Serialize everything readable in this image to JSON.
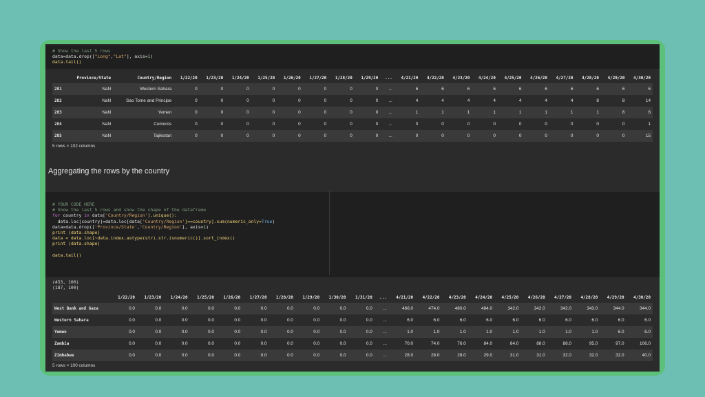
{
  "cell1": {
    "code_lines": [
      [
        {
          "t": "# Show the last 5 rows",
          "c": "c-comment"
        }
      ],
      [
        {
          "t": "data=data.drop([",
          "c": "c-op"
        },
        {
          "t": "\"Long\"",
          "c": "c-str"
        },
        {
          "t": ",",
          "c": "c-op"
        },
        {
          "t": "\"Lat\"",
          "c": "c-str"
        },
        {
          "t": "], axis=",
          "c": "c-op"
        },
        {
          "t": "1",
          "c": "c-num"
        },
        {
          "t": ")",
          "c": "c-op"
        }
      ],
      [
        {
          "t": "data.tail()",
          "c": "c-fn"
        }
      ]
    ]
  },
  "table1": {
    "headers": [
      "",
      "Province/State",
      "Country/Region",
      "1/22/20",
      "1/23/20",
      "1/24/20",
      "1/25/20",
      "1/26/20",
      "1/27/20",
      "1/28/20",
      "1/29/20",
      "...",
      "4/21/20",
      "4/22/20",
      "4/23/20",
      "4/24/20",
      "4/25/20",
      "4/26/20",
      "4/27/20",
      "4/28/20",
      "4/29/20",
      "4/30/20"
    ],
    "rows": [
      [
        "281",
        "NaN",
        "Western Sahara",
        "0",
        "0",
        "0",
        "0",
        "0",
        "0",
        "0",
        "0",
        "...",
        "6",
        "6",
        "6",
        "6",
        "6",
        "6",
        "6",
        "6",
        "6",
        "6"
      ],
      [
        "282",
        "NaN",
        "Sao Tome and Principe",
        "0",
        "0",
        "0",
        "0",
        "0",
        "0",
        "0",
        "0",
        "...",
        "4",
        "4",
        "4",
        "4",
        "4",
        "4",
        "4",
        "8",
        "8",
        "14"
      ],
      [
        "283",
        "NaN",
        "Yemen",
        "0",
        "0",
        "0",
        "0",
        "0",
        "0",
        "0",
        "0",
        "...",
        "1",
        "1",
        "1",
        "1",
        "1",
        "1",
        "1",
        "1",
        "6",
        "6"
      ],
      [
        "284",
        "NaN",
        "Comoros",
        "0",
        "0",
        "0",
        "0",
        "0",
        "0",
        "0",
        "0",
        "...",
        "0",
        "0",
        "0",
        "0",
        "0",
        "0",
        "0",
        "0",
        "0",
        "1"
      ],
      [
        "285",
        "NaN",
        "Tajikistan",
        "0",
        "0",
        "0",
        "0",
        "0",
        "0",
        "0",
        "0",
        "...",
        "0",
        "0",
        "0",
        "0",
        "0",
        "0",
        "0",
        "0",
        "0",
        "15"
      ]
    ],
    "shape_note": "5 rows × 102 columns"
  },
  "markdown": {
    "heading": "Aggregating the rows by the country"
  },
  "cell2": {
    "code_lines": [
      [
        {
          "t": "# YOUR CODE HERE",
          "c": "c-comment"
        }
      ],
      [
        {
          "t": "# Show the last 5 rows and show the shape of the dataframe",
          "c": "c-comment"
        }
      ],
      [
        {
          "t": "for",
          "c": "c-kw"
        },
        {
          "t": " country ",
          "c": "c-op"
        },
        {
          "t": "in",
          "c": "c-kw"
        },
        {
          "t": " data[",
          "c": "c-op"
        },
        {
          "t": "'Country/Region'",
          "c": "c-str"
        },
        {
          "t": "].unique():",
          "c": "c-fn"
        }
      ],
      [
        {
          "t": "  data.loc[country]=data.loc[data[",
          "c": "c-op"
        },
        {
          "t": "'Country/Region'",
          "c": "c-str"
        },
        {
          "t": "]==country].sum(numeric_only=",
          "c": "c-fn"
        },
        {
          "t": "True",
          "c": "c-cls"
        },
        {
          "t": ")",
          "c": "c-op"
        }
      ],
      [
        {
          "t": "data=data.drop([",
          "c": "c-op"
        },
        {
          "t": "'Province/State'",
          "c": "c-str"
        },
        {
          "t": ",",
          "c": "c-op"
        },
        {
          "t": "'Country/Region'",
          "c": "c-str"
        },
        {
          "t": "], axis=",
          "c": "c-op"
        },
        {
          "t": "1",
          "c": "c-num"
        },
        {
          "t": ")",
          "c": "c-op"
        }
      ],
      [
        {
          "t": "print",
          "c": "c-fn"
        },
        {
          "t": " (data.shape)",
          "c": "c-fn"
        }
      ],
      [
        {
          "t": "data = data.loc[~data.index.astype(str).str.isnumeric()].sort_index()",
          "c": "c-fn"
        }
      ],
      [
        {
          "t": "print",
          "c": "c-fn"
        },
        {
          "t": " (data.shape)",
          "c": "c-fn"
        }
      ],
      [
        {
          "t": "",
          "c": "c-op"
        }
      ],
      [
        {
          "t": "data.tail()",
          "c": "c-fn"
        }
      ]
    ],
    "stdout": "(453, 100)\n(187, 100)"
  },
  "table2": {
    "headers": [
      "",
      "1/22/20",
      "1/23/20",
      "1/24/20",
      "1/25/20",
      "1/26/20",
      "1/27/20",
      "1/28/20",
      "1/29/20",
      "1/30/20",
      "1/31/20",
      "...",
      "4/21/20",
      "4/22/20",
      "4/23/20",
      "4/24/20",
      "4/25/20",
      "4/26/20",
      "4/27/20",
      "4/28/20",
      "4/29/20",
      "4/30/20"
    ],
    "rows": [
      [
        "West Bank and Gaza",
        "0.0",
        "0.0",
        "0.0",
        "0.0",
        "0.0",
        "0.0",
        "0.0",
        "0.0",
        "0.0",
        "0.0",
        "...",
        "466.0",
        "474.0",
        "480.0",
        "484.0",
        "342.0",
        "342.0",
        "342.0",
        "343.0",
        "344.0",
        "344.0"
      ],
      [
        "Western Sahara",
        "0.0",
        "0.0",
        "0.0",
        "0.0",
        "0.0",
        "0.0",
        "0.0",
        "0.0",
        "0.0",
        "0.0",
        "...",
        "6.0",
        "6.0",
        "6.0",
        "6.0",
        "6.0",
        "6.0",
        "6.0",
        "6.0",
        "6.0",
        "6.0"
      ],
      [
        "Yemen",
        "0.0",
        "0.0",
        "0.0",
        "0.0",
        "0.0",
        "0.0",
        "0.0",
        "0.0",
        "0.0",
        "0.0",
        "...",
        "1.0",
        "1.0",
        "1.0",
        "1.0",
        "1.0",
        "1.0",
        "1.0",
        "1.0",
        "6.0",
        "6.0"
      ],
      [
        "Zambia",
        "0.0",
        "0.0",
        "0.0",
        "0.0",
        "0.0",
        "0.0",
        "0.0",
        "0.0",
        "0.0",
        "0.0",
        "...",
        "70.0",
        "74.0",
        "76.0",
        "84.0",
        "84.0",
        "88.0",
        "88.0",
        "95.0",
        "97.0",
        "106.0"
      ],
      [
        "Zimbabwe",
        "0.0",
        "0.0",
        "0.0",
        "0.0",
        "0.0",
        "0.0",
        "0.0",
        "0.0",
        "0.0",
        "0.0",
        "...",
        "28.0",
        "28.0",
        "28.0",
        "29.0",
        "31.0",
        "31.0",
        "32.0",
        "32.0",
        "32.0",
        "40.0"
      ]
    ],
    "shape_note": "5 rows × 100 columns"
  },
  "colors": {
    "background": "#6dbfb3",
    "frame": "#5cc07a",
    "notebook": "#2b2b2b",
    "code_bg": "#1f1f1f"
  }
}
